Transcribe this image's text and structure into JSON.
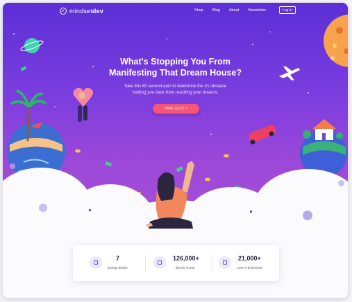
{
  "brand": {
    "name_light": "mindset",
    "name_bold": "dev"
  },
  "nav": {
    "links": [
      "Shop",
      "Blog",
      "About",
      "Newsletter"
    ],
    "login_label": "Log In"
  },
  "hero": {
    "headline_line1": "What's Stopping You From",
    "headline_line2": "Manifesting That Dream House?",
    "subtext_line1": "Take this 60 second quiz to determine the #1 obstacle",
    "subtext_line2": "holding you back from reaching your dreams.",
    "cta_label": "TAKE QUIZ"
  },
  "stats": [
    {
      "value": "7",
      "label": "Energy Blocks",
      "icon": "energy-icon"
    },
    {
      "value": "126,000+",
      "label": "Blocks Found",
      "icon": "block-icon"
    },
    {
      "value": "21,000+",
      "label": "Lives Transformed",
      "icon": "lives-icon"
    }
  ],
  "colors": {
    "hero_top": "#5b2fd6",
    "hero_bottom": "#a44fd6",
    "cta": "#f4567a",
    "stat_text": "#2b2540"
  }
}
